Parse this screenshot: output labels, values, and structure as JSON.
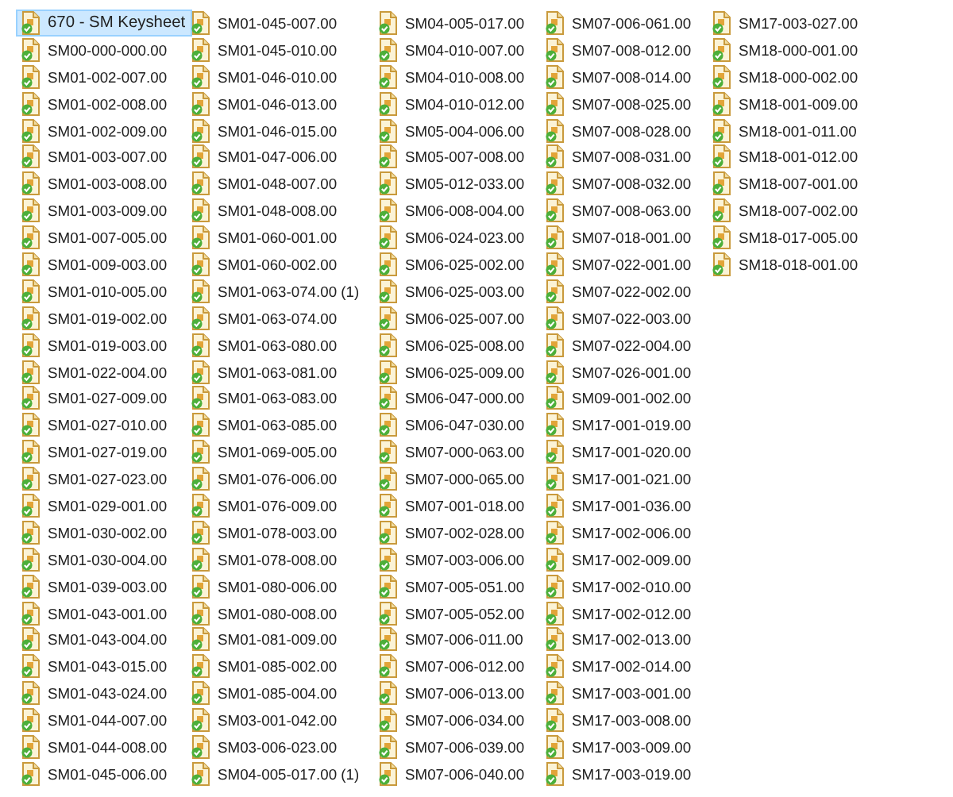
{
  "files": [
    {
      "name": "670 - SM Keysheet",
      "selected": true
    },
    {
      "name": "SM00-000-000.00",
      "selected": false
    },
    {
      "name": "SM01-002-007.00",
      "selected": false
    },
    {
      "name": "SM01-002-008.00",
      "selected": false
    },
    {
      "name": "SM01-002-009.00",
      "selected": false
    },
    {
      "name": "SM01-003-007.00",
      "selected": false
    },
    {
      "name": "SM01-003-008.00",
      "selected": false
    },
    {
      "name": "SM01-003-009.00",
      "selected": false
    },
    {
      "name": "SM01-007-005.00",
      "selected": false
    },
    {
      "name": "SM01-009-003.00",
      "selected": false
    },
    {
      "name": "SM01-010-005.00",
      "selected": false
    },
    {
      "name": "SM01-019-002.00",
      "selected": false
    },
    {
      "name": "SM01-019-003.00",
      "selected": false
    },
    {
      "name": "SM01-022-004.00",
      "selected": false
    },
    {
      "name": "SM01-027-009.00",
      "selected": false
    },
    {
      "name": "SM01-027-010.00",
      "selected": false
    },
    {
      "name": "SM01-027-019.00",
      "selected": false
    },
    {
      "name": "SM01-027-023.00",
      "selected": false
    },
    {
      "name": "SM01-029-001.00",
      "selected": false
    },
    {
      "name": "SM01-030-002.00",
      "selected": false
    },
    {
      "name": "SM01-030-004.00",
      "selected": false
    },
    {
      "name": "SM01-039-003.00",
      "selected": false
    },
    {
      "name": "SM01-043-001.00",
      "selected": false
    },
    {
      "name": "SM01-043-004.00",
      "selected": false
    },
    {
      "name": "SM01-043-015.00",
      "selected": false
    },
    {
      "name": "SM01-043-024.00",
      "selected": false
    },
    {
      "name": "SM01-044-007.00",
      "selected": false
    },
    {
      "name": "SM01-044-008.00",
      "selected": false
    },
    {
      "name": "SM01-045-006.00",
      "selected": false
    },
    {
      "name": "SM01-045-007.00",
      "selected": false
    },
    {
      "name": "SM01-045-010.00",
      "selected": false
    },
    {
      "name": "SM01-046-010.00",
      "selected": false
    },
    {
      "name": "SM01-046-013.00",
      "selected": false
    },
    {
      "name": "SM01-046-015.00",
      "selected": false
    },
    {
      "name": "SM01-047-006.00",
      "selected": false
    },
    {
      "name": "SM01-048-007.00",
      "selected": false
    },
    {
      "name": "SM01-048-008.00",
      "selected": false
    },
    {
      "name": "SM01-060-001.00",
      "selected": false
    },
    {
      "name": "SM01-060-002.00",
      "selected": false
    },
    {
      "name": "SM01-063-074.00 (1)",
      "selected": false
    },
    {
      "name": "SM01-063-074.00",
      "selected": false
    },
    {
      "name": "SM01-063-080.00",
      "selected": false
    },
    {
      "name": "SM01-063-081.00",
      "selected": false
    },
    {
      "name": "SM01-063-083.00",
      "selected": false
    },
    {
      "name": "SM01-063-085.00",
      "selected": false
    },
    {
      "name": "SM01-069-005.00",
      "selected": false
    },
    {
      "name": "SM01-076-006.00",
      "selected": false
    },
    {
      "name": "SM01-076-009.00",
      "selected": false
    },
    {
      "name": "SM01-078-003.00",
      "selected": false
    },
    {
      "name": "SM01-078-008.00",
      "selected": false
    },
    {
      "name": "SM01-080-006.00",
      "selected": false
    },
    {
      "name": "SM01-080-008.00",
      "selected": false
    },
    {
      "name": "SM01-081-009.00",
      "selected": false
    },
    {
      "name": "SM01-085-002.00",
      "selected": false
    },
    {
      "name": "SM01-085-004.00",
      "selected": false
    },
    {
      "name": "SM03-001-042.00",
      "selected": false
    },
    {
      "name": "SM03-006-023.00",
      "selected": false
    },
    {
      "name": "SM04-005-017.00 (1)",
      "selected": false
    },
    {
      "name": "SM04-005-017.00",
      "selected": false
    },
    {
      "name": "SM04-010-007.00",
      "selected": false
    },
    {
      "name": "SM04-010-008.00",
      "selected": false
    },
    {
      "name": "SM04-010-012.00",
      "selected": false
    },
    {
      "name": "SM05-004-006.00",
      "selected": false
    },
    {
      "name": "SM05-007-008.00",
      "selected": false
    },
    {
      "name": "SM05-012-033.00",
      "selected": false
    },
    {
      "name": "SM06-008-004.00",
      "selected": false
    },
    {
      "name": "SM06-024-023.00",
      "selected": false
    },
    {
      "name": "SM06-025-002.00",
      "selected": false
    },
    {
      "name": "SM06-025-003.00",
      "selected": false
    },
    {
      "name": "SM06-025-007.00",
      "selected": false
    },
    {
      "name": "SM06-025-008.00",
      "selected": false
    },
    {
      "name": "SM06-025-009.00",
      "selected": false
    },
    {
      "name": "SM06-047-000.00",
      "selected": false
    },
    {
      "name": "SM06-047-030.00",
      "selected": false
    },
    {
      "name": "SM07-000-063.00",
      "selected": false
    },
    {
      "name": "SM07-000-065.00",
      "selected": false
    },
    {
      "name": "SM07-001-018.00",
      "selected": false
    },
    {
      "name": "SM07-002-028.00",
      "selected": false
    },
    {
      "name": "SM07-003-006.00",
      "selected": false
    },
    {
      "name": "SM07-005-051.00",
      "selected": false
    },
    {
      "name": "SM07-005-052.00",
      "selected": false
    },
    {
      "name": "SM07-006-011.00",
      "selected": false
    },
    {
      "name": "SM07-006-012.00",
      "selected": false
    },
    {
      "name": "SM07-006-013.00",
      "selected": false
    },
    {
      "name": "SM07-006-034.00",
      "selected": false
    },
    {
      "name": "SM07-006-039.00",
      "selected": false
    },
    {
      "name": "SM07-006-040.00",
      "selected": false
    },
    {
      "name": "SM07-006-061.00",
      "selected": false
    },
    {
      "name": "SM07-008-012.00",
      "selected": false
    },
    {
      "name": "SM07-008-014.00",
      "selected": false
    },
    {
      "name": "SM07-008-025.00",
      "selected": false
    },
    {
      "name": "SM07-008-028.00",
      "selected": false
    },
    {
      "name": "SM07-008-031.00",
      "selected": false
    },
    {
      "name": "SM07-008-032.00",
      "selected": false
    },
    {
      "name": "SM07-008-063.00",
      "selected": false
    },
    {
      "name": "SM07-018-001.00",
      "selected": false
    },
    {
      "name": "SM07-022-001.00",
      "selected": false
    },
    {
      "name": "SM07-022-002.00",
      "selected": false
    },
    {
      "name": "SM07-022-003.00",
      "selected": false
    },
    {
      "name": "SM07-022-004.00",
      "selected": false
    },
    {
      "name": "SM07-026-001.00",
      "selected": false
    },
    {
      "name": "SM09-001-002.00",
      "selected": false
    },
    {
      "name": "SM17-001-019.00",
      "selected": false
    },
    {
      "name": "SM17-001-020.00",
      "selected": false
    },
    {
      "name": "SM17-001-021.00",
      "selected": false
    },
    {
      "name": "SM17-001-036.00",
      "selected": false
    },
    {
      "name": "SM17-002-006.00",
      "selected": false
    },
    {
      "name": "SM17-002-009.00",
      "selected": false
    },
    {
      "name": "SM17-002-010.00",
      "selected": false
    },
    {
      "name": "SM17-002-012.00",
      "selected": false
    },
    {
      "name": "SM17-002-013.00",
      "selected": false
    },
    {
      "name": "SM17-002-014.00",
      "selected": false
    },
    {
      "name": "SM17-003-001.00",
      "selected": false
    },
    {
      "name": "SM17-003-008.00",
      "selected": false
    },
    {
      "name": "SM17-003-009.00",
      "selected": false
    },
    {
      "name": "SM17-003-019.00",
      "selected": false
    },
    {
      "name": "SM17-003-027.00",
      "selected": false
    },
    {
      "name": "SM18-000-001.00",
      "selected": false
    },
    {
      "name": "SM18-000-002.00",
      "selected": false
    },
    {
      "name": "SM18-001-009.00",
      "selected": false
    },
    {
      "name": "SM18-001-011.00",
      "selected": false
    },
    {
      "name": "SM18-001-012.00",
      "selected": false
    },
    {
      "name": "SM18-007-001.00",
      "selected": false
    },
    {
      "name": "SM18-007-002.00",
      "selected": false
    },
    {
      "name": "SM18-017-005.00",
      "selected": false
    },
    {
      "name": "SM18-018-001.00",
      "selected": false
    }
  ]
}
